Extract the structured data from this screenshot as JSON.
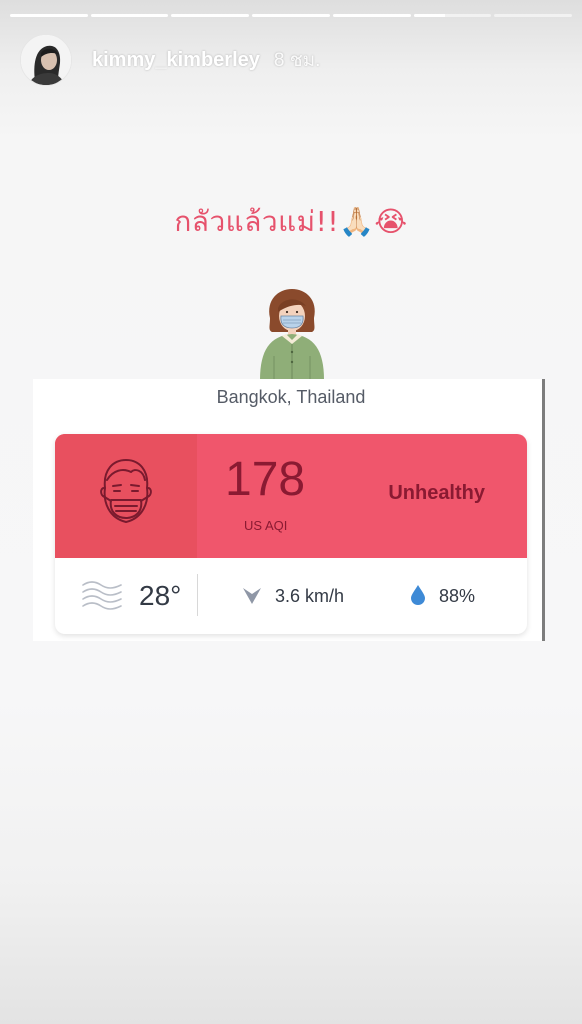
{
  "story": {
    "segments": [
      1,
      1,
      1,
      1,
      1,
      0.4,
      0
    ],
    "username": "kimmy_kimberley",
    "time_ago": "8 ชม.",
    "caption": "กลัวแล้วแม่!!🙏🏻😭"
  },
  "aqi_widget": {
    "location": "Bangkok, Thailand",
    "aqi_value": "178",
    "aqi_unit": "US AQI",
    "status": "Unhealthy",
    "temperature": "28°",
    "wind": "3.6 km/h",
    "humidity": "88%",
    "colors": {
      "status_bg": "#f0566c",
      "face_bg": "#e8505f",
      "status_text": "#8a1a32"
    },
    "icons": {
      "face": "face-mask-icon",
      "weather": "haze-icon",
      "wind": "wind-direction-icon",
      "humidity": "water-drop-icon"
    }
  }
}
